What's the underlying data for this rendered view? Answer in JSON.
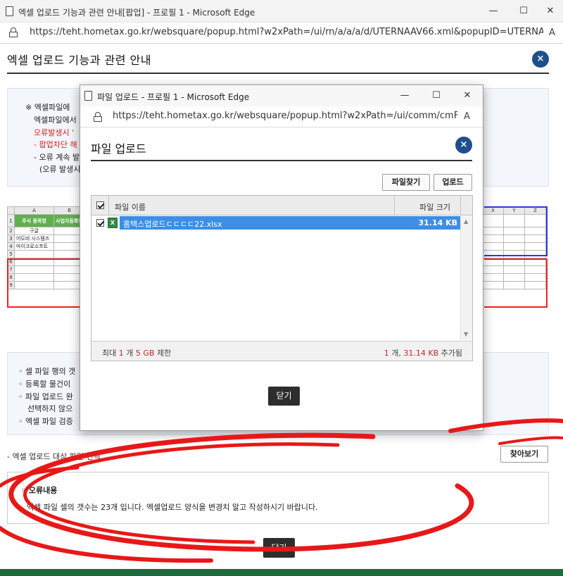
{
  "outer_window": {
    "title": "엑셀 업로드 기능과 관련 안내[팝업] - 프로필 1 - Microsoft Edge",
    "url": "https://teht.hometax.go.kr/websquare/popup.html?w2xPath=/ui/rn/a/a/a/d/UTERNAAV66.xml&popupID=UTERNAAV66&w...",
    "minimize_glyph": "—",
    "maximize_glyph": "☐",
    "close_glyph": "✕"
  },
  "outer_page": {
    "heading": "엑셀 업로드 기능과 관련 안내",
    "close_glyph": "×",
    "notice_lines": [
      {
        "text": "※ 엑셀파일에 ",
        "red": false
      },
      {
        "text": "엑셀파일에서",
        "red": false
      },
      {
        "text": "오류발생시 '",
        "red": true
      },
      {
        "text": "- 팝업차단 해",
        "red": true
      },
      {
        "text": "- 오류 계속 발",
        "red": false
      },
      {
        "text": "(오류 발생시",
        "red": false
      }
    ],
    "sheet": {
      "col_headers": [
        "A",
        "B"
      ],
      "header_row": [
        "주식 종목명",
        "사업자등록번"
      ],
      "rows": [
        "구글",
        "어도비 시스템즈",
        "마이크로소프트"
      ],
      "row_numbers": [
        "1",
        "2",
        "3",
        "4",
        "5",
        "6",
        "7",
        "8",
        "9"
      ],
      "right_cols": [
        "X",
        "Y",
        "Z"
      ]
    },
    "info_lines": [
      "◦ 셀 파일 행의 갯",
      "◦ 등록할 물건이",
      "◦ 파일 업로드 완",
      "선택하지 않으",
      "◦ 엑셀 파일 검증"
    ],
    "upload_target_label": "- 엑셀 업로드 대상 파일 선택",
    "browse_label": "찾아보기",
    "error_title": "◦ 오류내용",
    "error_message": "엑셀 파일 셀의 갯수는 23개 입니다. 엑셀업로드 양식을 변경치 말고 작성하시기 바랍니다.",
    "close_label": "닫기"
  },
  "inner_window": {
    "title": "파일 업로드 - 프로필 1 - Microsoft Edge",
    "url": "https://teht.hometax.go.kr/websquare/popup.html?w2xPath=/ui/comm/cmFileUp...",
    "minimize_glyph": "—",
    "maximize_glyph": "☐",
    "close_glyph": "✕",
    "heading": "파일 업로드",
    "close_glyph_circle": "×",
    "find_file_label": "파일찾기",
    "upload_label": "업로드",
    "grid": {
      "col_name": "파일 이름",
      "col_size": "파일 크기",
      "files": [
        {
          "name": "홈택스업로드ㄷㄷㄷㄷ22.xlsx",
          "size": "31.14 KB",
          "checked": true
        }
      ]
    },
    "footer": {
      "left_prefix": "최대 ",
      "left_count": "1",
      "left_mid": " 개 ",
      "left_size": "5 GB",
      "left_suffix": " 제한",
      "right_count": "1",
      "right_mid": " 개, ",
      "right_size": "31.14 KB",
      "right_suffix": " 추가됨"
    },
    "close_label": "닫기"
  },
  "colors": {
    "accent_blue": "#1f4e8c",
    "selection": "#3d8ee6",
    "warning_red": "#d62020",
    "dark_button": "#2d2d2d"
  }
}
